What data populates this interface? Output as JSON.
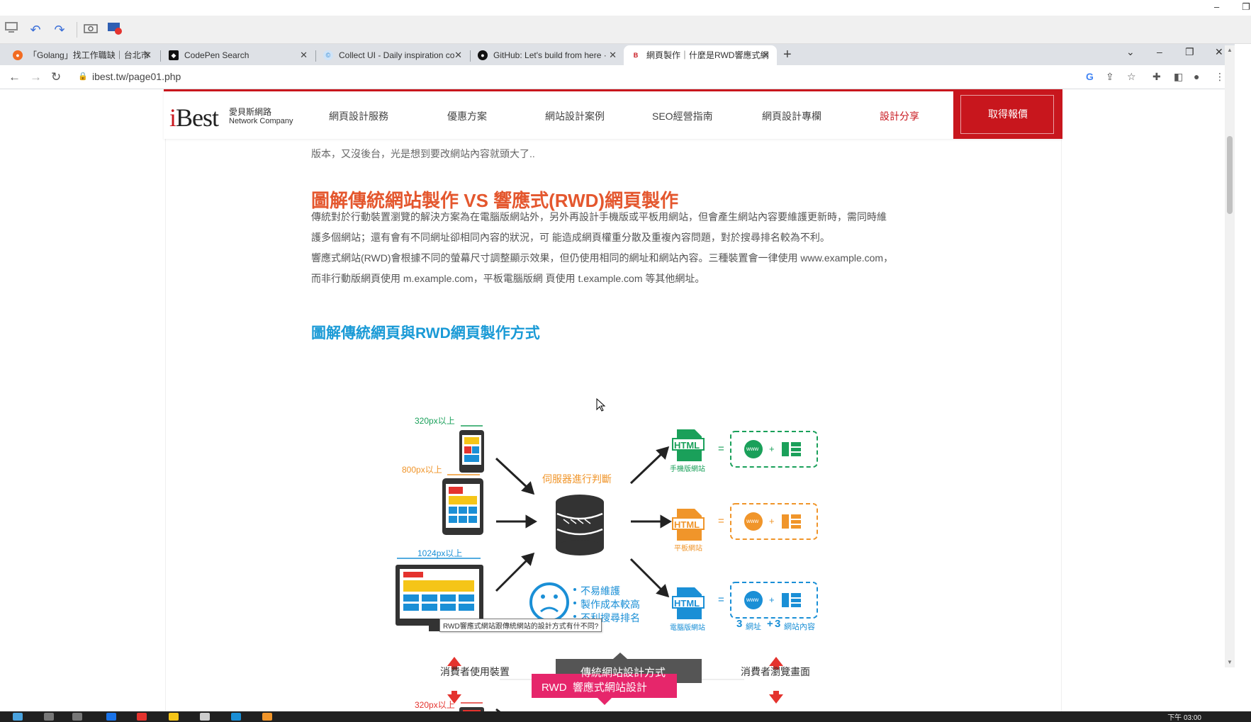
{
  "window": {
    "minimize": "–",
    "maximize": "❐"
  },
  "tabs": [
    {
      "title": "「Golang」找工作職缺｜台北市",
      "close": "✕"
    },
    {
      "title": "CodePen Search",
      "close": "✕"
    },
    {
      "title": "Collect UI - Daily inspiration co",
      "close": "✕"
    },
    {
      "title": "GitHub: Let's build from here ·",
      "close": "✕"
    },
    {
      "title": "網頁製作｜什麼是RWD響應式網",
      "close": "✕"
    }
  ],
  "new_tab": "+",
  "window_controls": {
    "dropdown": "⌄",
    "minimize": "–",
    "restore": "❐",
    "close": "✕"
  },
  "address": {
    "url": "ibest.tw/page01.php"
  },
  "site": {
    "logo": {
      "main": "Best",
      "i": "i",
      "cn": "愛貝斯網路",
      "en": "Network Company"
    },
    "menu": [
      "網頁設計服務",
      "優惠方案",
      "網站設計案例",
      "SEO經營指南",
      "網頁設計專欄",
      "設計分享"
    ],
    "quote_button": "取得報價"
  },
  "article": {
    "intro_tail": "版本，又沒後台，光是想到要改網站內容就頭大了..",
    "heading": "圖解傳統網站製作 VS 響應式(RWD)網頁製作",
    "paragraph_lines": [
      "傳統對於行動裝置瀏覽的解決方案為在電腦版網站外，另外再設計手機版或平板用網站，但會產生網站內容要維護更新時，需同時維",
      "護多個網站；還有會有不同網址卻相同內容的狀況，可 能造成網頁權重分散及重複內容問題，對於搜尋排名較為不利。",
      "響應式網站(RWD)會根據不同的螢幕尺寸調整顯示效果，但仍使用相同的網址和網站內容。三種裝置會一律使用 www.example.com，",
      "而非行動版網頁使用 m.example.com，平板電腦版網 頁使用 t.example.com 等其他網址。"
    ],
    "subheading": "圖解傳統網頁與RWD網頁製作方式"
  },
  "diagram": {
    "size_labels": [
      "320px以上",
      "800px以上",
      "1024px以上",
      "320px以上"
    ],
    "server_label": "伺服器進行判斷",
    "html_badge": "HTML",
    "site_labels": [
      "手機版網站",
      "平板網站",
      "電腦版網站"
    ],
    "www": "www",
    "eq": "=",
    "plus": "+",
    "cons": [
      "不易維護",
      "製作成本較高",
      "不利搜尋排名"
    ],
    "summary": {
      "n1": "3",
      "t1": "網址",
      "plus": "+",
      "n2": "3",
      "t2": "網站內容"
    },
    "tooltip": "RWD響應式網站跟傳統網站的設計方式有什不同?",
    "consumer_device": "消費者使用裝置",
    "consumer_view": "消費者瀏覽畫面",
    "traditional_label": "傳統網站設計方式",
    "rwd_label": "RWD  響應式網站設計"
  },
  "taskbar": {
    "clock": "下午 03:00"
  },
  "colors": {
    "brand_red": "#c8161d",
    "heading_orange": "#e4572e",
    "subheading_blue": "#1a9ad6",
    "phone_green": "#1aa05a",
    "tablet_orange": "#f0952a",
    "desktop_blue": "#1a8fd6",
    "rwd_pink": "#e6266b"
  }
}
